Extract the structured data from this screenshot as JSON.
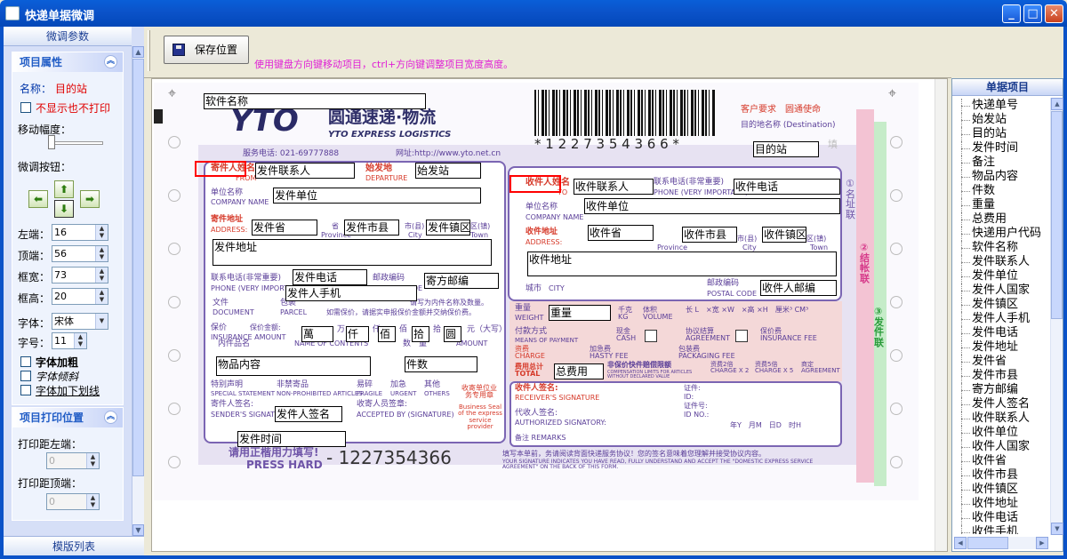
{
  "window": {
    "title": "快递单据微调"
  },
  "left_panel": {
    "header": "微调参数",
    "footer": "模版列表",
    "props": {
      "title": "项目属性",
      "name_label": "名称：",
      "name_value": "目的站",
      "hide_label": "不显示也不打印",
      "move_range_label": "移动幅度：",
      "fine_buttons_label": "微调按钮：",
      "left_label": "左端：",
      "left_value": "16",
      "top_label": "顶端：",
      "top_value": "56",
      "width_label": "框宽：",
      "width_value": "73",
      "height_label": "框高：",
      "height_value": "20",
      "font_label": "字体：",
      "font_value": "宋体",
      "size_label": "字号：",
      "size_value": "11",
      "bold_label": "字体加粗",
      "italic_label": "字体倾斜",
      "underline_label": "字体加下划线"
    },
    "print": {
      "title": "项目打印位置",
      "left_label": "打印距左端：",
      "left_value": "0",
      "top_label": "打印距顶端：",
      "top_value": "0"
    }
  },
  "toolbar": {
    "save_label": "保存位置",
    "hint": "使用键盘方向键移动项目，ctrl+方向键调整项目宽度高度。"
  },
  "ticket": {
    "company_cn": "圆通速递·物流",
    "company_en": "YTO EXPRESS LOGISTICS",
    "logo_text": "YTO",
    "hotline": "服务电话: 021-69777888",
    "website": "网址:http://www.yto.net.cn",
    "slogan": "客户要求　圆通使命",
    "barcode_number": "* 1 2 2 7 3 5 4 3 6 6 *",
    "dest_label": "目的地名称 (Destination)",
    "sender_label": "寄件人姓名",
    "from_label": "FROM",
    "departure_label": "始发地",
    "departure_en": "DEPARTURE",
    "sender_company_label": "单位名称",
    "company_name_en": "COMPANY NAME",
    "sender_addr_label": "寄件地址",
    "address_en": "ADDRESS:",
    "province_label": "省",
    "province_en": "Province",
    "city_label": "市(县)",
    "city_en": "City",
    "town_label": "区(镇)",
    "town_en": "Town",
    "phone_label": "联系电话(非常重要)",
    "phone_en": "PHONE (VERY IMPORTANT)",
    "postal_label": "邮政编码",
    "postal_en": "POSTAL CODE",
    "doc_label": "文件",
    "doc_en": "DOCUMENT",
    "parcel_label": "包裹",
    "parcel_en": "PARCEL",
    "insure_note": "如需保价，请据实申报保价金额并交纳保价费。",
    "declare_note": "请写为内件名称及数量。",
    "insure_label": "保价",
    "insure_amount": "保价金额:",
    "insure_en": "INSURANCE AMOUNT",
    "wan": "万",
    "qian": "仟",
    "bai": "佰",
    "shi": "拾",
    "yuan": "元（大写）",
    "contents_label": "内件品名",
    "contents_en": "NAME OF CONTENTS",
    "qty_label": "数　量",
    "amount_en": "AMOUNT",
    "special_label": "特别声明",
    "special_en": "SPECIAL STATEMENT",
    "nonprohib": "非禁寄品",
    "nonprohib_en": "NON-PROHIBITED ARTICLES",
    "fragile": "易碎",
    "urgent": "加急",
    "others": "其他",
    "fragile_en": "FRAGILE",
    "urgent_en": "URGENT",
    "others_en": "OTHERS",
    "seal_cn": "收寄单位业务专用章",
    "seal_en": "Business Seal of the express service provider",
    "sender_sign": "寄件人签名:",
    "sender_sign_en": "SENDER'S SIGNATURE",
    "accepted_label": "收寄人员签章:",
    "accepted_en": "ACCEPTED BY (SIGNATURE)",
    "press_cn": "请用正楷用力填写!",
    "press_en": "PRESS HARD",
    "press_number": "- 1227354366",
    "receiver_label": "收件人姓名",
    "to_label": "TO",
    "receiver_addr_label": "收件地址",
    "city_label2": "城市",
    "city_en2": "CITY",
    "weight_label": "重量",
    "weight_en": "WEIGHT",
    "kg": "千克 KG",
    "volume": "体积 VOLUME",
    "dims": "长 L　×宽 ×W　×高 ×H　厘米³ CM³",
    "payment": "付款方式",
    "payment_en": "MEANS OF PAYMENT",
    "cash": "现金 CASH",
    "agreement": "协议结算 AGREEMENT",
    "insurance_fee": "保价费 INSURANCE FEE",
    "charge": "资费 CHARGE",
    "hasty": "加急费 HASTY FEE",
    "packaging": "包装费 PACKAGING FEE",
    "total": "费用总计 TOTAL",
    "comp_note": "非保价快件赔偿限额",
    "comp_en": "COMPENSATION LIMITS FOR ARTICLES WITHOUT DECLARED VALUE",
    "charge2": "资费2倍 CHARGE X 2",
    "charge5": "资费5倍 CHARGE X 5",
    "agree2": "商定 AGREEMENT",
    "recv_sign": "收件人签名:",
    "recv_sign_en": "RECEIVER'S SIGNATURE",
    "auth_sign": "代收人签名:",
    "auth_sign_en": "AUTHORIZED SIGNATORY:",
    "cert": "证件:",
    "id": "ID:",
    "cert_no": "证件号:",
    "id_no": "ID NO.:",
    "date": "年Y　月M　日D　时H",
    "remarks": "备注 REMARKS",
    "agreement_note": "填写本单前，务请阅读背面快递服务协议！您的签名意味着您理解并接受协议内容。",
    "agreement_en": "YOUR SIGNATURE INDICATES YOU HAVE READ, FULLY UNDERSTAND AND ACCEPT THE \"DOMESTIC EXPRESS SERVICE AGREEMENT\" ON THE BACK OF THIS FORM.",
    "copy1": "①名址联",
    "copy2": "②结帐联",
    "copy3": "③发件联",
    "fill_hint": "填"
  },
  "fields": {
    "software_name": "软件名称",
    "dest_station": "目的站",
    "sender_contact": "发件联系人",
    "origin_station": "始发站",
    "sender_company": "发件单位",
    "sender_province": "发件省",
    "sender_city": "发件市县",
    "sender_district": "发件镇区",
    "sender_address": "发件地址",
    "sender_phone": "发件电话",
    "sender_mobile": "发件人手机",
    "sender_postcode": "寄方邮编",
    "wan_box": "萬",
    "qian_box": "仟",
    "bai_box": "佰",
    "shi_box": "拾",
    "yuan_box": "圆",
    "contents": "物品内容",
    "pieces": "件数",
    "sender_signature": "发件人签名",
    "send_time": "发件时间",
    "receiver_contact": "收件联系人",
    "receiver_phone": "收件电话",
    "receiver_company": "收件单位",
    "receiver_province": "收件省",
    "receiver_city": "收件市县",
    "receiver_district": "收件镇区",
    "receiver_address": "收件地址",
    "receiver_postcode": "收件人邮编",
    "weight": "重量",
    "total_fee": "总费用"
  },
  "right_panel": {
    "header": "单据项目",
    "items": [
      "快递单号",
      "始发站",
      "目的站",
      "发件时间",
      "备注",
      "物品内容",
      "件数",
      "重量",
      "总费用",
      "快递用户代码",
      "软件名称",
      "发件联系人",
      "发件单位",
      "发件人国家",
      "发件镇区",
      "发件人手机",
      "发件电话",
      "发件地址",
      "发件省",
      "发件市县",
      "寄方邮编",
      "发件人签名",
      "收件联系人",
      "收件单位",
      "收件人国家",
      "收件省",
      "收件市县",
      "收件镇区",
      "收件地址",
      "收件电话",
      "收件手机"
    ]
  },
  "colors": {
    "title_bar": "#0a5fd8",
    "accent_purple": "#6f55a8",
    "label_red": "#d63a2a",
    "hint_magenta": "#e01fd6",
    "selection_red": "#ff0000"
  }
}
